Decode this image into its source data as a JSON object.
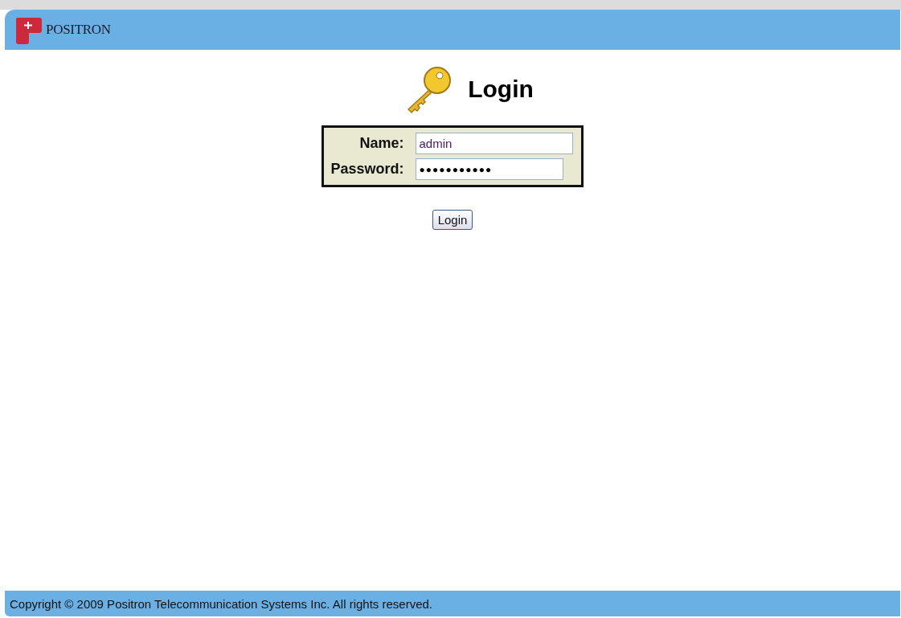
{
  "header": {
    "logo_text": "POSITRON"
  },
  "login": {
    "title": "Login",
    "fields": [
      {
        "label": "Name:",
        "value": "admin",
        "kind": "text"
      },
      {
        "label": "Password:",
        "value": "●●●●●●●●●●●",
        "kind": "password"
      }
    ],
    "button": "Login"
  },
  "footer": {
    "text": "Copyright © 2009 Positron Telecommunication Systems Inc. All rights reserved."
  }
}
